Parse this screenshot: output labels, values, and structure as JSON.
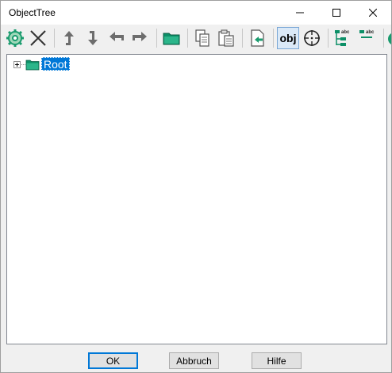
{
  "window": {
    "title": "ObjectTree"
  },
  "toolbar": {
    "icons": [
      "gear-icon",
      "close-x-icon",
      "move-up-icon",
      "move-down-icon",
      "move-left-icon",
      "move-right-icon",
      "folder-icon",
      "copy-icon",
      "paste-icon",
      "import-icon",
      "obj-icon",
      "target-icon",
      "tree-abc-icon",
      "list-abc-icon",
      "green-partial-icon"
    ],
    "obj_label": "obj"
  },
  "tree": {
    "root_label": "Root"
  },
  "buttons": {
    "ok": "OK",
    "cancel": "Abbruch",
    "help": "Hilfe"
  },
  "colors": {
    "selection": "#0078d7",
    "folder": "#0c8f67",
    "icon_gray": "#6d6d6d",
    "icon_green": "#1a9b6e",
    "accent_blue": "#0078d7"
  }
}
